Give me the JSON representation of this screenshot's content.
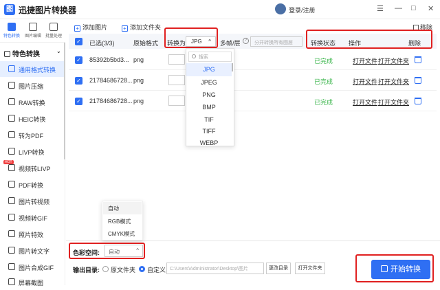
{
  "app": {
    "title": "迅捷图片转换器",
    "logo_char": "图",
    "login": "登录/注册",
    "win_min": "—",
    "win_max": "□",
    "win_close": "✕",
    "menu": "☰"
  },
  "toptabs": [
    {
      "label": "特色转换"
    },
    {
      "label": "图片编辑"
    },
    {
      "label": "批量处理"
    }
  ],
  "sidebar": {
    "section": "特色转换",
    "items": [
      {
        "label": "通用格式转换"
      },
      {
        "label": "图片压缩"
      },
      {
        "label": "RAW转换"
      },
      {
        "label": "HEIC转换"
      },
      {
        "label": "转为PDF"
      },
      {
        "label": "LIVP转换"
      },
      {
        "label": "视频转LIVP"
      },
      {
        "label": "PDF转换"
      },
      {
        "label": "图片转视频"
      },
      {
        "label": "视频转GIF"
      },
      {
        "label": "照片特效"
      },
      {
        "label": "图片转文字"
      },
      {
        "label": "图片合成GIF"
      },
      {
        "label": "屏幕截图"
      }
    ],
    "hot_badge": "HOT"
  },
  "toolbar": {
    "add_image": "添加图片",
    "add_folder": "添加文件夹",
    "remove": "移除"
  },
  "table": {
    "selected": "已选(3/3)",
    "col_original": "原始格式",
    "col_convert_to": "转换为",
    "format_value": "JPG",
    "col_split": "多帧/层",
    "split_placeholder": "分开转换所有图层",
    "col_status": "转换状态",
    "col_actions": "操作",
    "col_delete": "删除",
    "rows": [
      {
        "name": "85392b5bd3...",
        "format": "png",
        "status": "已完成",
        "open_file": "打开文件",
        "open_folder": "打开文件夹"
      },
      {
        "name": "21784686728...",
        "format": "png",
        "status": "已完成",
        "open_file": "打开文件",
        "open_folder": "打开文件夹"
      },
      {
        "name": "21784686728...",
        "format": "png",
        "status": "已完成",
        "open_file": "打开文件",
        "open_folder": "打开文件夹"
      }
    ]
  },
  "format_dropdown": {
    "search_placeholder": "搜索",
    "options": [
      "JPG",
      "JPEG",
      "PNG",
      "BMP",
      "TIF",
      "TIFF",
      "WEBP"
    ],
    "selected": "JPG"
  },
  "color_space": {
    "label": "色彩空间:",
    "value": "自动",
    "options": [
      "自动",
      "RGB模式",
      "CMYK模式"
    ]
  },
  "output": {
    "label": "输出目录:",
    "opt_source": "原文件夹",
    "opt_custom": "自定义",
    "path": "C:\\Users\\Administrator\\Desktop\\图片",
    "change_dir": "更改目录",
    "open_folder": "打开文件夹"
  },
  "start_button": "开始转换",
  "colors": {
    "accent": "#2f6ff3",
    "success": "#39b54a",
    "highlight": "#e02020"
  }
}
